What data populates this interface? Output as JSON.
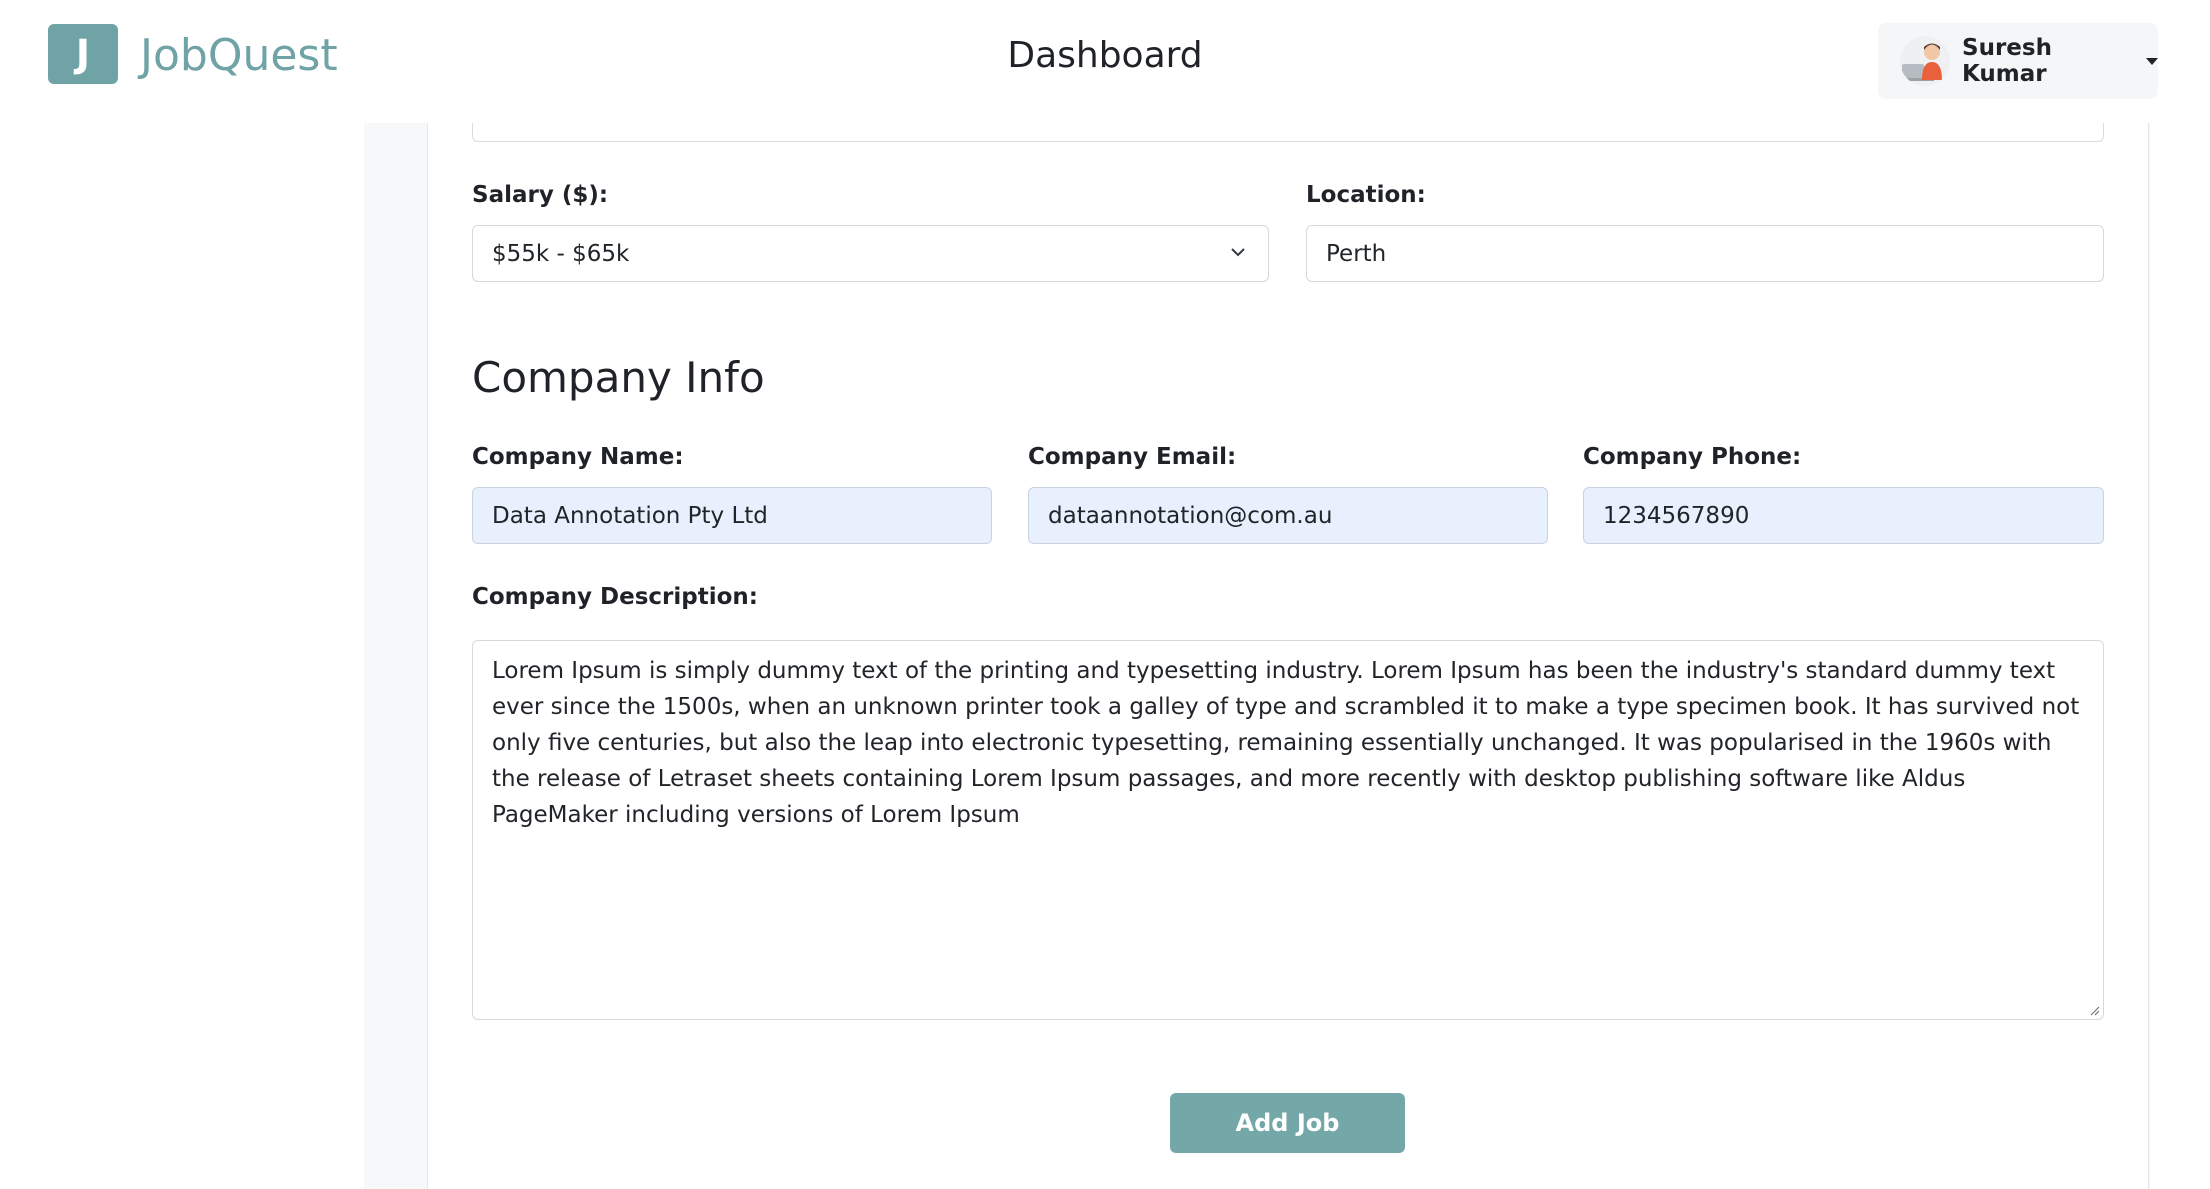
{
  "header": {
    "logo_letter": "J",
    "app_name": "JobQuest",
    "page_title": "Dashboard",
    "user_name": "Suresh Kumar",
    "avatar_icon": "user-avatar-icon",
    "menu_icon": "caret-down-icon"
  },
  "form": {
    "salary": {
      "label": "Salary ($):",
      "value": "$55k - $65k",
      "icon": "chevron-down-icon"
    },
    "location": {
      "label": "Location:",
      "value": "Perth"
    },
    "company_section_title": "Company Info",
    "company_name": {
      "label": "Company Name:",
      "value": "Data Annotation Pty Ltd"
    },
    "company_email": {
      "label": "Company Email:",
      "value": "dataannotation@com.au"
    },
    "company_phone": {
      "label": "Company Phone:",
      "value": "1234567890"
    },
    "company_description": {
      "label": "Company Description:",
      "value": "Lorem Ipsum is simply dummy text of the printing and typesetting industry. Lorem Ipsum has been the industry's standard dummy text ever since the 1500s, when an unknown printer took a galley of type and scrambled it to make a type specimen book. It has survived not only five centuries, but also the leap into electronic typesetting, remaining essentially unchanged. It was popularised in the 1960s with the release of Letraset sheets containing Lorem Ipsum passages, and more recently with desktop publishing software like Aldus PageMaker including versions of Lorem Ipsum"
    },
    "submit_label": "Add Job"
  },
  "colors": {
    "brand": "#6fa3a5",
    "button": "#74a7a8",
    "autofill": "#e8f0fe"
  }
}
